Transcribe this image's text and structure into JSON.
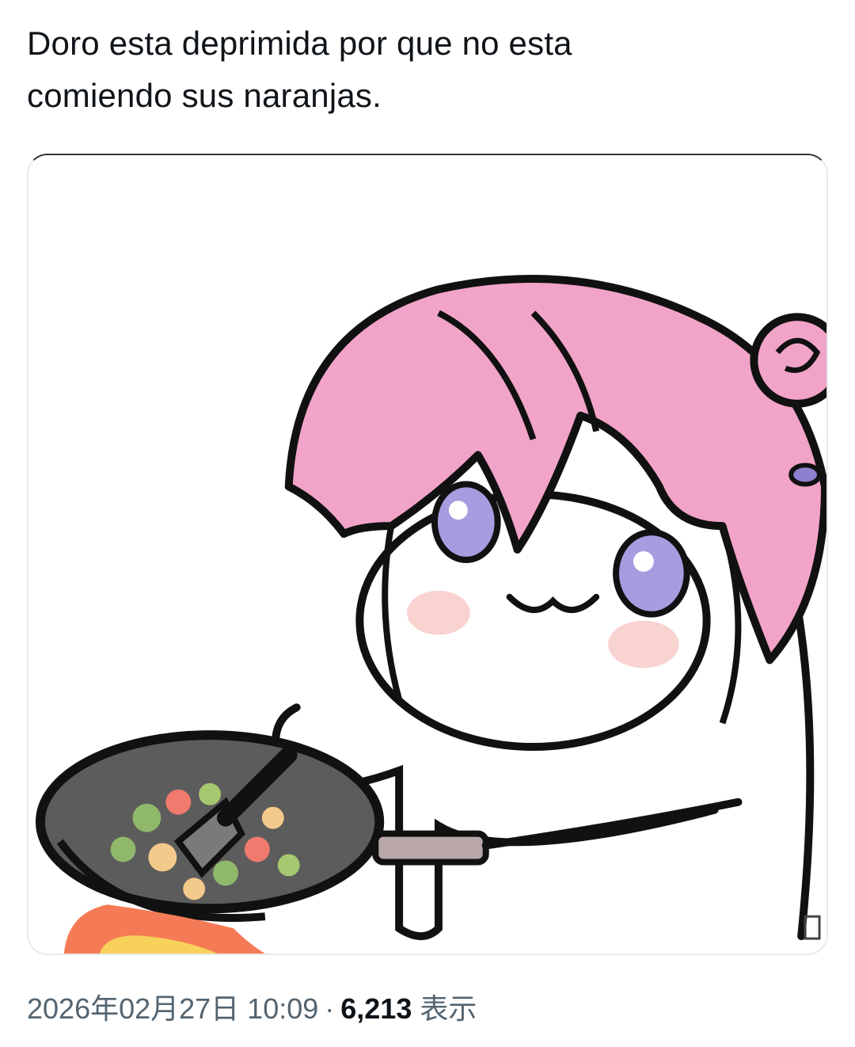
{
  "tweet": {
    "text": "Doro esta deprimida por que no esta\ncomiendo sus naranjas."
  },
  "media": {
    "alt": "",
    "colors": {
      "hair": "#f2a4c8",
      "hair_shadow": "#e27fab",
      "eyes": "#a99be0",
      "pan": "#5f5f5f",
      "flame": "#f57b57"
    }
  },
  "meta": {
    "datetime": "2026年02月27日 10:09",
    "separator": "·",
    "views_count": "6,213",
    "views_label": "表示"
  }
}
